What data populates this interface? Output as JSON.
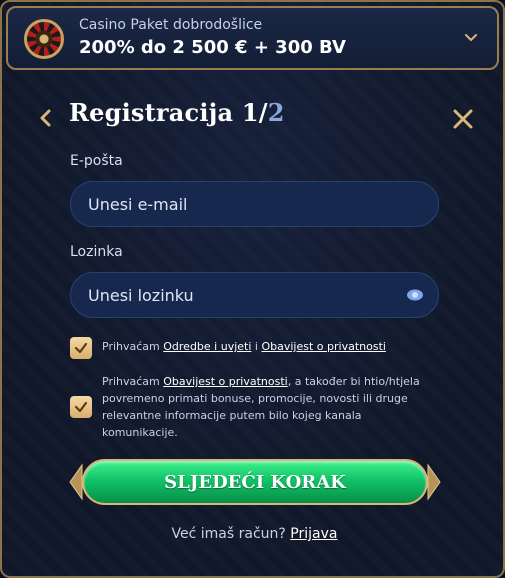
{
  "bonus": {
    "subtitle": "Casino Paket dobrodošlice",
    "title": "200% do 2 500 € + 300 BV"
  },
  "header": {
    "title": "Registracija 1/",
    "step_total": "2"
  },
  "form": {
    "email_label": "E-pošta",
    "email_placeholder": "Unesi e-mail",
    "password_label": "Lozinka",
    "password_placeholder": "Unesi lozinku"
  },
  "consent_terms": {
    "prefix": "Prihvaćam ",
    "terms_link": "Odredbe i uvjeti",
    "middle": " i ",
    "privacy_link": "Obavijest o privatnosti",
    "checked": true
  },
  "consent_marketing": {
    "prefix": "Prihvaćam ",
    "privacy_link": "Obavijest o privatnosti",
    "suffix_line1": ", a također bi htio/htjela",
    "line2": "povremeno primati bonuse, promocije, novosti ili druge",
    "line3": "relevantne informacije putem bilo kojeg kanala",
    "line4": "komunikacije.",
    "checked": true
  },
  "cta": {
    "label": "SLJEDEĆI KORAK"
  },
  "footer": {
    "question": "Već imaš račun? ",
    "login_link": "Prijava"
  },
  "colors": {
    "gold": "#c9a25f",
    "cta_green": "#11c367",
    "panel": "#101729",
    "input_bg": "#16284d"
  },
  "icons": {
    "back": "chevron-left-icon",
    "close": "close-icon",
    "expand": "chevron-down-icon",
    "password_toggle": "eye-icon",
    "checkbox": "checkmark-icon",
    "bonus": "roulette-icon"
  }
}
